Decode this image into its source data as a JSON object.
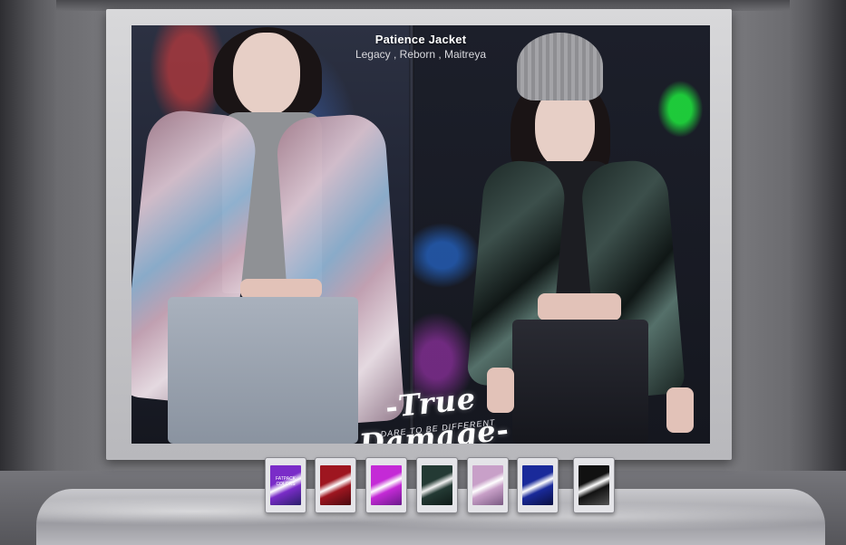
{
  "poster": {
    "title": "Patience Jacket",
    "subtitle": "Legacy , Reborn , Maitreya",
    "brand": "True Damage",
    "tagline": "DARE TO BE DIFFERENT"
  },
  "vendor_panels": [
    {
      "name": "fatpack",
      "label": "FATPACK COLORS",
      "colors": [
        "#7a2cc8",
        "#ffffff",
        "#2a1f6a"
      ]
    },
    {
      "name": "red",
      "label": "",
      "colors": [
        "#9e1620",
        "#ffffff",
        "#4a0a10"
      ]
    },
    {
      "name": "magenta",
      "label": "",
      "colors": [
        "#c42ad6",
        "#ffffff",
        "#6a1a8a"
      ]
    },
    {
      "name": "green-dark",
      "label": "",
      "colors": [
        "#243a34",
        "#f2f2f2",
        "#0f1a17"
      ]
    },
    {
      "name": "lavender",
      "label": "",
      "colors": [
        "#c8a0c8",
        "#ffffff",
        "#7a5a82"
      ]
    },
    {
      "name": "blue",
      "label": "",
      "colors": [
        "#1a2a9a",
        "#ffffff",
        "#0a0f40"
      ]
    },
    {
      "name": "black-white",
      "label": "",
      "colors": [
        "#111111",
        "#ffffff",
        "#555555"
      ]
    }
  ]
}
